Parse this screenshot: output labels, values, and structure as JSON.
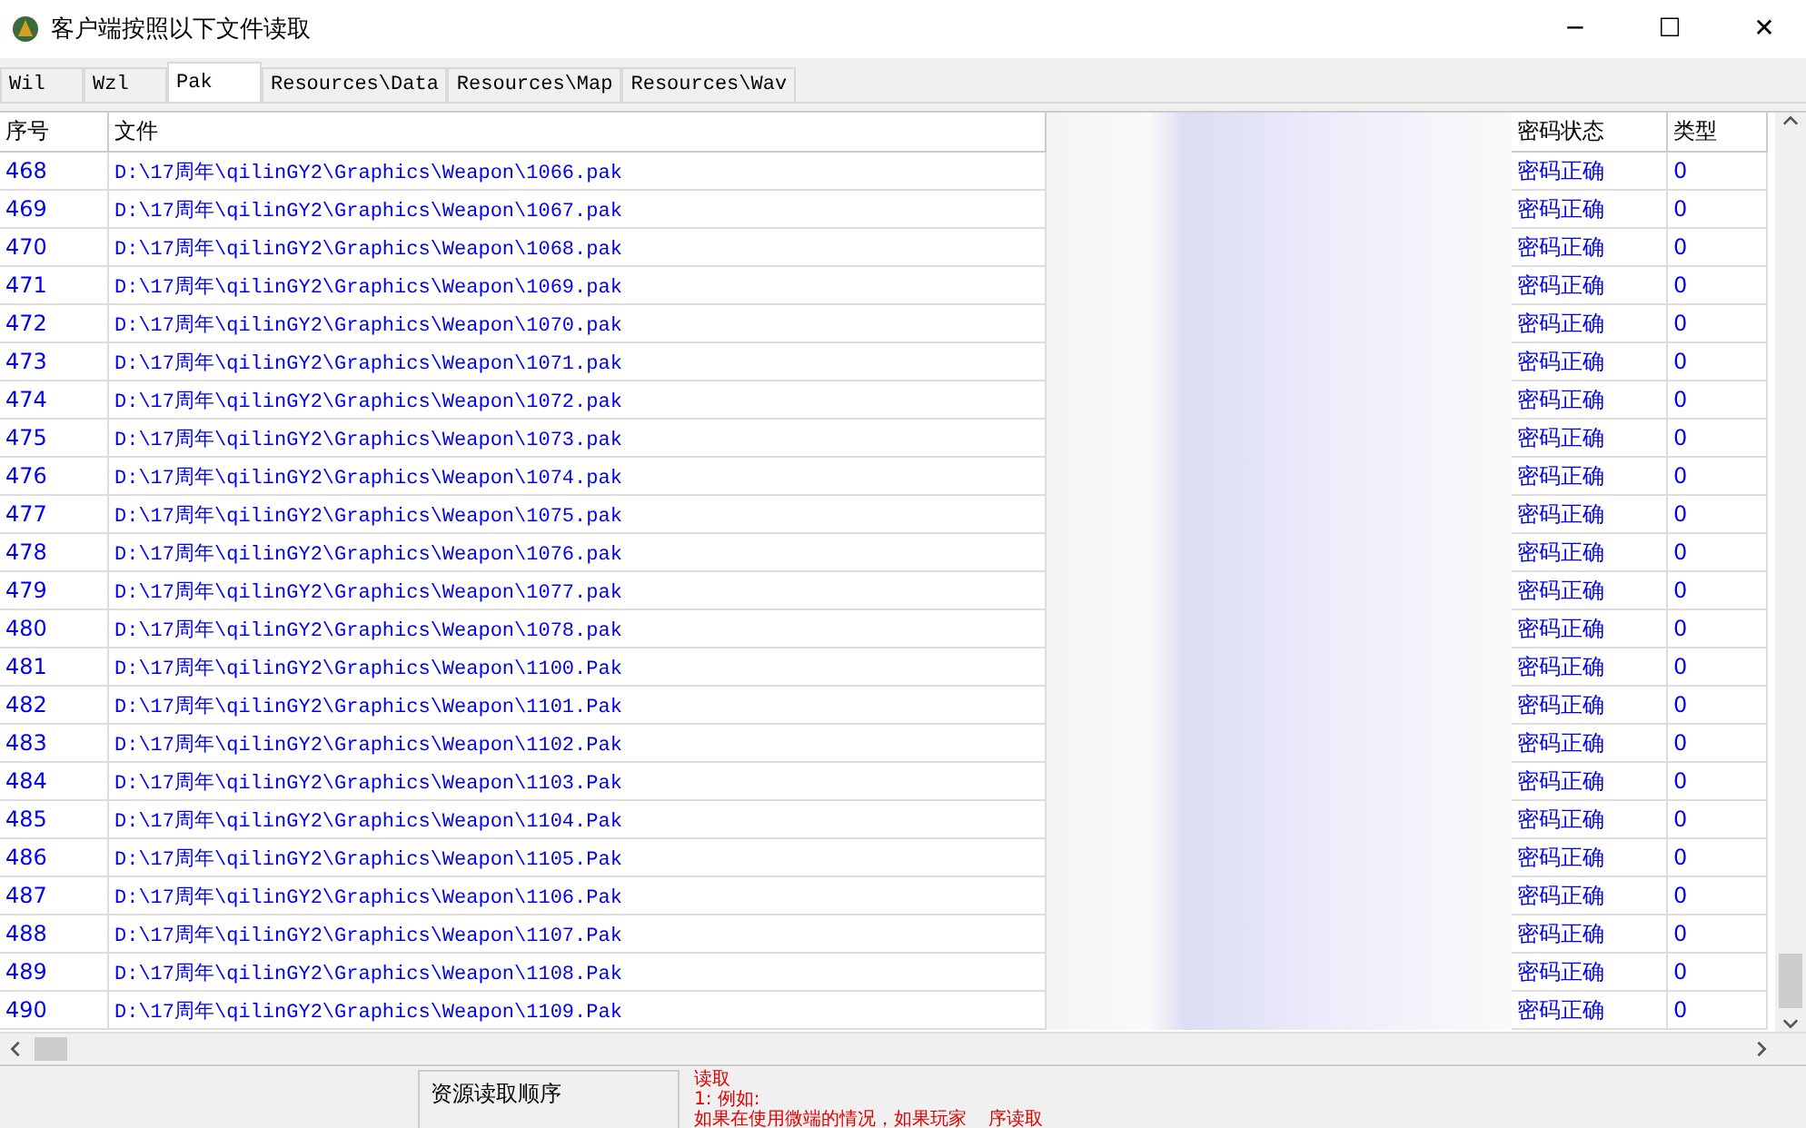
{
  "window": {
    "title": "客户端按照以下文件读取",
    "controls": [
      "─",
      "☐",
      "✕"
    ]
  },
  "tabs": [
    {
      "label": "Wil",
      "selected": false
    },
    {
      "label": "Wzl",
      "selected": false
    },
    {
      "label": "Pak",
      "selected": true
    },
    {
      "label": "Resources\\Data",
      "selected": false
    },
    {
      "label": "Resources\\Map",
      "selected": false
    },
    {
      "label": "Resources\\Wav",
      "selected": false
    }
  ],
  "table": {
    "columns": [
      "序号",
      "文件",
      "密码状态",
      "类型"
    ],
    "rows": [
      [
        "468",
        "D:\\17周年\\qilinGY2\\Graphics\\Weapon\\1066.pak",
        "密码正确",
        "0"
      ],
      [
        "469",
        "D:\\17周年\\qilinGY2\\Graphics\\Weapon\\1067.pak",
        "密码正确",
        "0"
      ],
      [
        "470",
        "D:\\17周年\\qilinGY2\\Graphics\\Weapon\\1068.pak",
        "密码正确",
        "0"
      ],
      [
        "471",
        "D:\\17周年\\qilinGY2\\Graphics\\Weapon\\1069.pak",
        "密码正确",
        "0"
      ],
      [
        "472",
        "D:\\17周年\\qilinGY2\\Graphics\\Weapon\\1070.pak",
        "密码正确",
        "0"
      ],
      [
        "473",
        "D:\\17周年\\qilinGY2\\Graphics\\Weapon\\1071.pak",
        "密码正确",
        "0"
      ],
      [
        "474",
        "D:\\17周年\\qilinGY2\\Graphics\\Weapon\\1072.pak",
        "密码正确",
        "0"
      ],
      [
        "475",
        "D:\\17周年\\qilinGY2\\Graphics\\Weapon\\1073.pak",
        "密码正确",
        "0"
      ],
      [
        "476",
        "D:\\17周年\\qilinGY2\\Graphics\\Weapon\\1074.pak",
        "密码正确",
        "0"
      ],
      [
        "477",
        "D:\\17周年\\qilinGY2\\Graphics\\Weapon\\1075.pak",
        "密码正确",
        "0"
      ],
      [
        "478",
        "D:\\17周年\\qilinGY2\\Graphics\\Weapon\\1076.pak",
        "密码正确",
        "0"
      ],
      [
        "479",
        "D:\\17周年\\qilinGY2\\Graphics\\Weapon\\1077.pak",
        "密码正确",
        "0"
      ],
      [
        "480",
        "D:\\17周年\\qilinGY2\\Graphics\\Weapon\\1078.pak",
        "密码正确",
        "0"
      ],
      [
        "481",
        "D:\\17周年\\qilinGY2\\Graphics\\Weapon\\1100.Pak",
        "密码正确",
        "0"
      ],
      [
        "482",
        "D:\\17周年\\qilinGY2\\Graphics\\Weapon\\1101.Pak",
        "密码正确",
        "0"
      ],
      [
        "483",
        "D:\\17周年\\qilinGY2\\Graphics\\Weapon\\1102.Pak",
        "密码正确",
        "0"
      ],
      [
        "484",
        "D:\\17周年\\qilinGY2\\Graphics\\Weapon\\1103.Pak",
        "密码正确",
        "0"
      ],
      [
        "485",
        "D:\\17周年\\qilinGY2\\Graphics\\Weapon\\1104.Pak",
        "密码正确",
        "0"
      ],
      [
        "486",
        "D:\\17周年\\qilinGY2\\Graphics\\Weapon\\1105.Pak",
        "密码正确",
        "0"
      ],
      [
        "487",
        "D:\\17周年\\qilinGY2\\Graphics\\Weapon\\1106.Pak",
        "密码正确",
        "0"
      ],
      [
        "488",
        "D:\\17周年\\qilinGY2\\Graphics\\Weapon\\1107.Pak",
        "密码正确",
        "0"
      ],
      [
        "489",
        "D:\\17周年\\qilinGY2\\Graphics\\Weapon\\1108.Pak",
        "密码正确",
        "0"
      ],
      [
        "490",
        "D:\\17周年\\qilinGY2\\Graphics\\Weapon\\1109.Pak",
        "密码正确",
        "0"
      ]
    ]
  },
  "bottom": {
    "group_label": "资源读取顺序",
    "notes": [
      "读取",
      "1: 例如:",
      "如果在使用微端的情况，如果玩家",
      "序读取"
    ]
  }
}
